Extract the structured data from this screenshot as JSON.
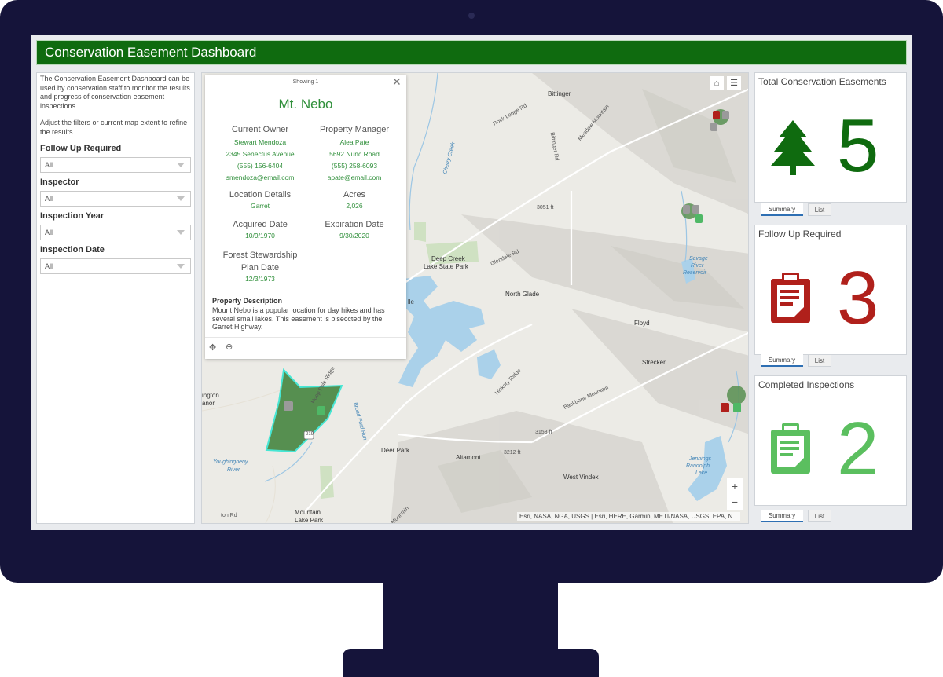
{
  "header": {
    "title": "Conservation Easement Dashboard"
  },
  "sidebar": {
    "intro": "The Conservation Easement Dashboard can be used by conservation staff to monitor the results and progress of conservation easement inspections.",
    "instructions": "Adjust the filters or current map extent to refine the results.",
    "filters": [
      {
        "label": "Follow Up Required",
        "value": "All"
      },
      {
        "label": "Inspector",
        "value": "All"
      },
      {
        "label": "Inspection Year",
        "value": "All"
      },
      {
        "label": "Inspection Date",
        "value": "All"
      }
    ]
  },
  "popup": {
    "showing": "Showing 1",
    "close_icon": "close-icon",
    "title": "Mt. Nebo",
    "current_owner": {
      "label": "Current Owner",
      "name": "Stewart Mendoza",
      "address": "2345 Senectus Avenue",
      "phone": "(555) 156-6404",
      "email": "smendoza@email.com"
    },
    "property_manager": {
      "label": "Property Manager",
      "name": "Alea Pate",
      "address": "5692 Nunc Road",
      "phone": "(555) 258-6093",
      "email": "apate@email.com"
    },
    "location": {
      "label": "Location Details",
      "value": "Garret"
    },
    "acres": {
      "label": "Acres",
      "value": "2,026"
    },
    "acquired": {
      "label": "Acquired Date",
      "value": "10/9/1970"
    },
    "expiration": {
      "label": "Expiration Date",
      "value": "9/30/2020"
    },
    "stewardship": {
      "label_line1": "Forest Stewardship",
      "label_line2": "Plan Date",
      "value": "12/3/1973"
    },
    "description_title": "Property Description",
    "description": "Mount Nebo is a popular location for day hikes and has several small lakes. This easement is biseccted by the Garret Highway."
  },
  "map": {
    "places": {
      "bittinger": "Bittinger",
      "deep_creek_park": "Deep Creek",
      "deep_creek_park2": "Lake State Park",
      "north_glade": "North Glade",
      "floyd": "Floyd",
      "strecker": "Strecker",
      "deer_park": "Deer Park",
      "altamont": "Altamont",
      "west_vindex": "West Vindex",
      "mountain_lake_park": "Mountain",
      "mountain_lake_park2": "Lake Park",
      "ville": "lle",
      "ington": "ington",
      "anor": "anor",
      "ton_rd": "ton Rd"
    },
    "water": {
      "cherry_creek": "Cherry Creek",
      "savage_river": "Savage",
      "savage_river2": "River",
      "savage_river3": "Reservoir",
      "youghiogheny": "Youghiogheny",
      "youghiogheny2": "River",
      "jennings": "Jennings",
      "jennings2": "Randolph",
      "jennings3": "Lake",
      "broad_ford": "Broad Ford Run"
    },
    "roads": {
      "rock_lodge": "Rock Lodge Rd",
      "bittinger_rd": "Bittinger Rd",
      "meadow_mountain": "Meadow Mountain",
      "glendale": "Glendale Rd",
      "hickory": "Hickory Ridge",
      "backbone": "Backbone Mountain",
      "hoop_pole": "Hoop Pole Ridge",
      "elev1": "3051 ft",
      "elev2": "3158 ft",
      "elev3": "3212 ft",
      "mountain_label": "Mountain",
      "route": "219"
    },
    "attribution": "Esri, NASA, NGA, USGS | Esri, HERE, Garmin, METI/NASA, USGS, EPA, N...",
    "zoom_in": "+",
    "zoom_out": "−",
    "home_icon": "home-icon",
    "legend_icon": "legend-list-icon"
  },
  "cards": [
    {
      "title": "Total Conservation Easements",
      "value": "5",
      "color": "#0f6b0f",
      "icon": "tree-icon",
      "tab_summary": "Summary",
      "tab_list": "List"
    },
    {
      "title": "Follow Up Required",
      "value": "3",
      "color": "#b0201b",
      "icon": "clipboard-icon",
      "tab_summary": "Summary",
      "tab_list": "List"
    },
    {
      "title": "Completed Inspections",
      "value": "2",
      "color": "#5bbf5f",
      "icon": "clipboard-icon",
      "tab_summary": "Summary",
      "tab_list": "List"
    }
  ]
}
